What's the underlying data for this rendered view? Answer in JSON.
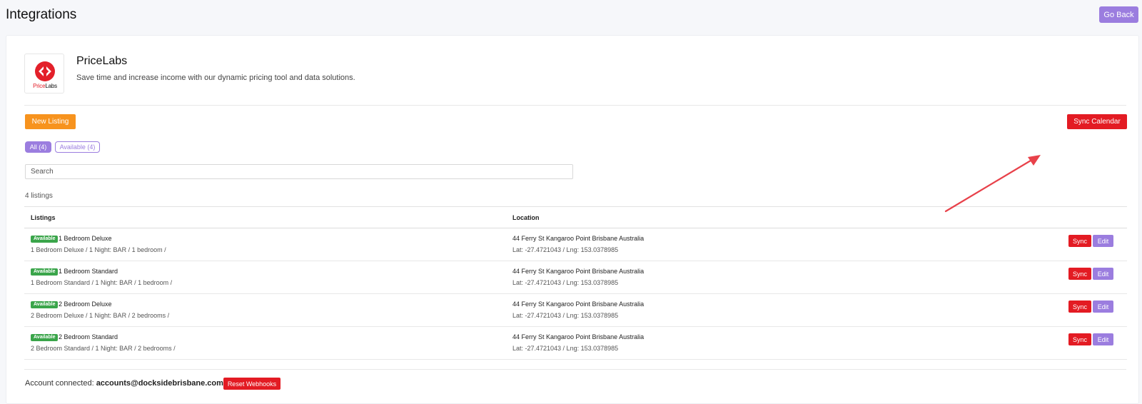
{
  "header": {
    "title": "Integrations",
    "go_back_label": "Go Back"
  },
  "integration": {
    "logo_text_red": "Price",
    "logo_text_dark": "Labs",
    "name": "PriceLabs",
    "description": "Save time and increase income with our dynamic pricing tool and data solutions."
  },
  "toolbar": {
    "new_listing_label": "New Listing",
    "sync_calendar_label": "Sync Calendar"
  },
  "filters": {
    "all_label": "All (4)",
    "available_label": "Available (4)"
  },
  "search": {
    "placeholder": "Search",
    "value": ""
  },
  "listing_count": "4 listings",
  "table": {
    "headers": {
      "listings": "Listings",
      "location": "Location"
    },
    "rows": [
      {
        "badge": "Available",
        "name": "1 Bedroom Deluxe",
        "detail": "1 Bedroom Deluxe / 1 Night: BAR / 1 bedroom /",
        "address": "44 Ferry St Kangaroo Point Brisbane Australia",
        "coords": "Lat: -27.4721043 / Lng: 153.0378985",
        "sync_label": "Sync",
        "edit_label": "Edit"
      },
      {
        "badge": "Available",
        "name": "1 Bedroom Standard",
        "detail": "1 Bedroom Standard / 1 Night: BAR / 1 bedroom /",
        "address": "44 Ferry St Kangaroo Point Brisbane Australia",
        "coords": "Lat: -27.4721043 / Lng: 153.0378985",
        "sync_label": "Sync",
        "edit_label": "Edit"
      },
      {
        "badge": "Available",
        "name": "2 Bedroom Deluxe",
        "detail": "2 Bedroom Deluxe / 1 Night: BAR / 2 bedrooms /",
        "address": "44 Ferry St Kangaroo Point Brisbane Australia",
        "coords": "Lat: -27.4721043 / Lng: 153.0378985",
        "sync_label": "Sync",
        "edit_label": "Edit"
      },
      {
        "badge": "Available",
        "name": "2 Bedroom Standard",
        "detail": "2 Bedroom Standard / 1 Night: BAR / 2 bedrooms /",
        "address": "44 Ferry St Kangaroo Point Brisbane Australia",
        "coords": "Lat: -27.4721043 / Lng: 153.0378985",
        "sync_label": "Sync",
        "edit_label": "Edit"
      }
    ]
  },
  "footer": {
    "account_label": "Account connected:",
    "account_email": "accounts@docksidebrisbane.com.au",
    "reset_webhooks_label": "Reset Webhooks"
  },
  "colors": {
    "accent_purple": "#9b7ddf",
    "danger_red": "#e31b23",
    "orange": "#f7931e",
    "available_green": "#3aa54a"
  },
  "icons": {
    "logo": "pricelabs-logo-icon",
    "annotation": "arrow-annotation-icon"
  }
}
